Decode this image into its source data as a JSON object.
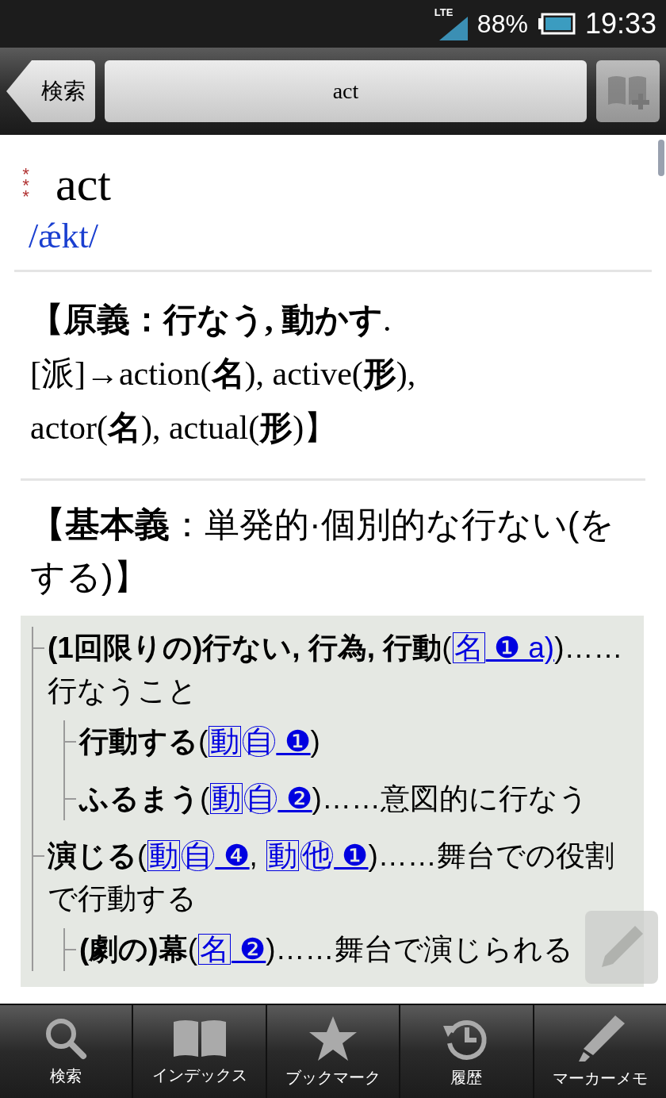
{
  "status_bar": {
    "network": "LTE",
    "battery": "88%",
    "time": "19:33"
  },
  "toolbar": {
    "back_button": "検索",
    "search_field": {
      "value": "act"
    },
    "bookmark_add_disabled": true
  },
  "entry": {
    "importance_mark": "***",
    "headword": "act",
    "pronunciation": "/ǽkt/",
    "origin": "**【原義：行なう, 動かす**.\n[派]→action(**名**), active(**形**),\nactor(**名**), actual(**形**)】",
    "basic_meaning": "**【基本義**：単発的·個別的な行ない(をする)】",
    "senses": [
      {
        "parts": [
          {
            "kind": "bold",
            "text": "(1回限りの)行ない, 行為, 行動"
          },
          {
            "kind": "text",
            "text": "("
          },
          {
            "kind": "link",
            "labels": [
              {
                "text": "名",
                "kind": "box"
              }
            ],
            "num": "❶",
            "suffix": "a)"
          },
          {
            "kind": "text",
            "text": ")……行なうこと"
          }
        ],
        "children": [
          {
            "parts": [
              {
                "kind": "bold",
                "text": "行動する"
              },
              {
                "kind": "text",
                "text": "("
              },
              {
                "kind": "link",
                "labels": [
                  {
                    "text": "動",
                    "kind": "box"
                  },
                  {
                    "text": "自",
                    "kind": "circle"
                  }
                ],
                "num": "❶"
              },
              {
                "kind": "text",
                "text": ")"
              }
            ]
          },
          {
            "parts": [
              {
                "kind": "bold",
                "text": "ふるまう"
              },
              {
                "kind": "text",
                "text": "("
              },
              {
                "kind": "link",
                "labels": [
                  {
                    "text": "動",
                    "kind": "box"
                  },
                  {
                    "text": "自",
                    "kind": "circle"
                  }
                ],
                "num": "❷"
              },
              {
                "kind": "text",
                "text": ")……意図的に行なう"
              }
            ]
          }
        ]
      },
      {
        "parts": [
          {
            "kind": "bold",
            "text": "演じる"
          },
          {
            "kind": "text",
            "text": "("
          },
          {
            "kind": "link",
            "labels": [
              {
                "text": "動",
                "kind": "box"
              },
              {
                "text": "自",
                "kind": "circle"
              }
            ],
            "num": "❹"
          },
          {
            "kind": "text",
            "text": ", "
          },
          {
            "kind": "link",
            "labels": [
              {
                "text": "動",
                "kind": "box"
              },
              {
                "text": "他",
                "kind": "circle"
              }
            ],
            "num": "❶"
          },
          {
            "kind": "text",
            "text": ")……舞台での役割で行動する"
          }
        ],
        "children": [
          {
            "parts": [
              {
                "kind": "bold",
                "text": "(劇の)幕"
              },
              {
                "kind": "text",
                "text": "("
              },
              {
                "kind": "link",
                "labels": [
                  {
                    "text": "名",
                    "kind": "box"
                  }
                ],
                "num": "❷"
              },
              {
                "kind": "text",
                "text": ")……舞台で演じられる"
              }
            ]
          }
        ]
      }
    ]
  },
  "tab_bar": [
    {
      "kind": "search",
      "label": "検索",
      "selected": false
    },
    {
      "kind": "index",
      "label": "インデックス",
      "selected": false
    },
    {
      "kind": "bookmark",
      "label": "ブックマーク",
      "selected": false
    },
    {
      "kind": "history",
      "label": "履歴",
      "selected": false
    },
    {
      "kind": "memo",
      "label": "マーカーメモ",
      "selected": false
    }
  ]
}
